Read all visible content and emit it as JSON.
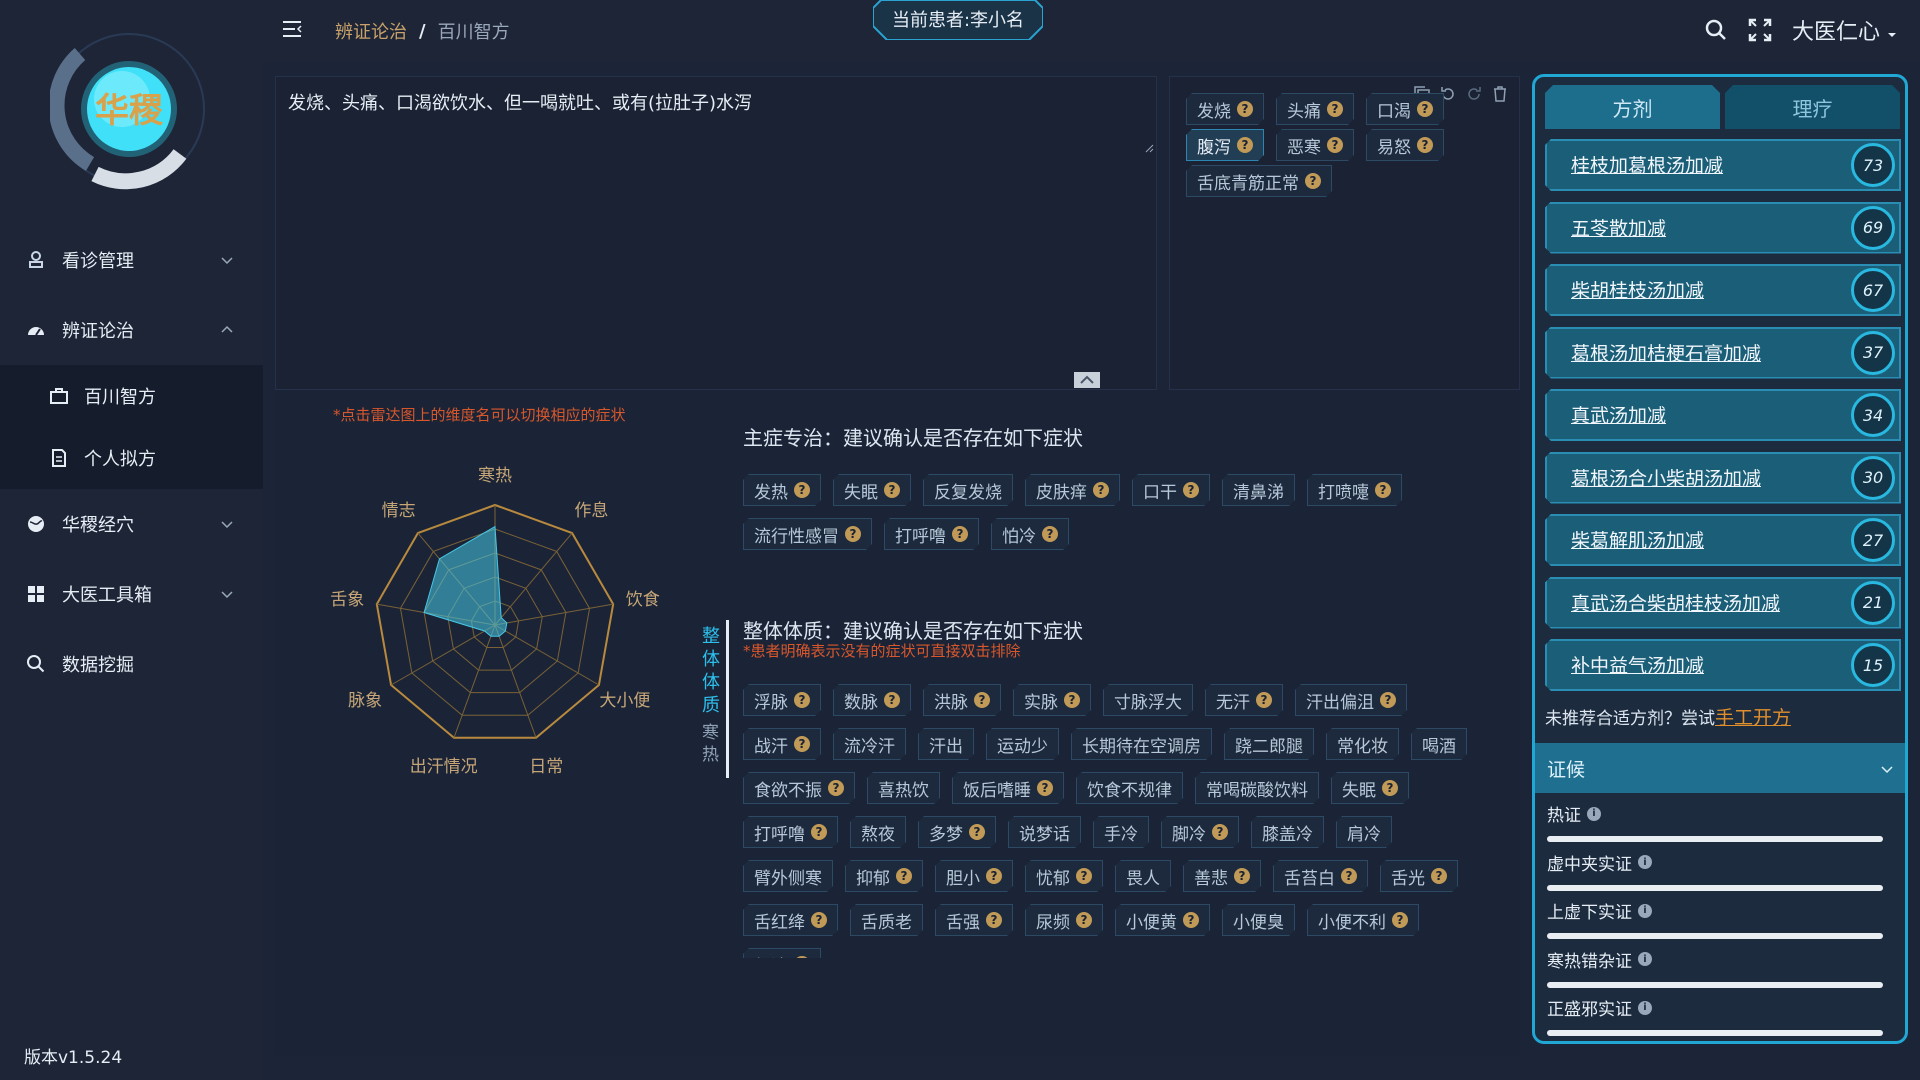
{
  "sidebar": {
    "logo_text": "华稷",
    "items": [
      {
        "label": "看诊管理"
      },
      {
        "label": "辨证论治"
      },
      {
        "label": "华稷经穴"
      },
      {
        "label": "大医工具箱"
      },
      {
        "label": "数据挖掘"
      }
    ],
    "sub_items": [
      {
        "label": "百川智方"
      },
      {
        "label": "个人拟方"
      }
    ],
    "version": "版本v1.5.24"
  },
  "header": {
    "breadcrumb": [
      "辨证论治",
      "/",
      "百川智方"
    ],
    "patient_label": "当前患者:李小名",
    "user_name": "大医仁心"
  },
  "symptom_input": {
    "value": "发烧、头痛、口渴欲饮水、但一喝就吐、或有(拉肚子)水泻"
  },
  "selected_tags": [
    {
      "label": "发烧",
      "selected": false
    },
    {
      "label": "头痛",
      "selected": false
    },
    {
      "label": "口渴",
      "selected": false
    },
    {
      "label": "腹泻",
      "selected": true
    },
    {
      "label": "恶寒",
      "selected": false
    },
    {
      "label": "易怒",
      "selected": false
    },
    {
      "label": "舌底青筋正常",
      "selected": false
    }
  ],
  "radar": {
    "hint": "*点击雷达图上的维度名可以切换相应的症状",
    "dimensions": [
      "寒热",
      "作息",
      "饮食",
      "大小便",
      "日常",
      "出汗情况",
      "脉象",
      "舌象",
      "情志"
    ],
    "levels": 5,
    "values": [
      0.82,
      0.08,
      0.1,
      0.1,
      0.1,
      0.1,
      0.1,
      0.6,
      0.72
    ]
  },
  "main_section": {
    "title": "主症专治：建议确认是否存在如下症状",
    "tags": [
      {
        "label": "发热",
        "q": true
      },
      {
        "label": "失眠",
        "q": true
      },
      {
        "label": "反复发烧",
        "q": false
      },
      {
        "label": "皮肤痒",
        "q": true
      },
      {
        "label": "口干",
        "q": true
      },
      {
        "label": "清鼻涕",
        "q": false
      },
      {
        "label": "打喷嚏",
        "q": true
      },
      {
        "label": "流行性感冒",
        "q": true
      },
      {
        "label": "打呼噜",
        "q": true
      },
      {
        "label": "怕冷",
        "q": true
      }
    ]
  },
  "constitution_section": {
    "side_tabs": [
      "整体体质",
      "寒热"
    ],
    "title": "整体体质：建议确认是否存在如下症状",
    "hint": "*患者明确表示没有的症状可直接双击排除",
    "tags": [
      {
        "label": "浮脉",
        "q": true
      },
      {
        "label": "数脉",
        "q": true
      },
      {
        "label": "洪脉",
        "q": true
      },
      {
        "label": "实脉",
        "q": true
      },
      {
        "label": "寸脉浮大",
        "q": false
      },
      {
        "label": "无汗",
        "q": true
      },
      {
        "label": "汗出偏沮",
        "q": true
      },
      {
        "label": "战汗",
        "q": true
      },
      {
        "label": "流冷汗",
        "q": false
      },
      {
        "label": "汗出",
        "q": false
      },
      {
        "label": "运动少",
        "q": false
      },
      {
        "label": "长期待在空调房",
        "q": false
      },
      {
        "label": "跷二郎腿",
        "q": false
      },
      {
        "label": "常化妆",
        "q": false
      },
      {
        "label": "喝酒",
        "q": false
      },
      {
        "label": "食欲不振",
        "q": true
      },
      {
        "label": "喜热饮",
        "q": false
      },
      {
        "label": "饭后嗜睡",
        "q": true
      },
      {
        "label": "饮食不规律",
        "q": false
      },
      {
        "label": "常喝碳酸饮料",
        "q": false
      },
      {
        "label": "失眠",
        "q": true
      },
      {
        "label": "打呼噜",
        "q": true
      },
      {
        "label": "熬夜",
        "q": false
      },
      {
        "label": "多梦",
        "q": true
      },
      {
        "label": "说梦话",
        "q": false
      },
      {
        "label": "手冷",
        "q": false
      },
      {
        "label": "脚冷",
        "q": true
      },
      {
        "label": "膝盖冷",
        "q": false
      },
      {
        "label": "肩冷",
        "q": false
      },
      {
        "label": "臂外侧寒",
        "q": false
      },
      {
        "label": "抑郁",
        "q": true
      },
      {
        "label": "胆小",
        "q": true
      },
      {
        "label": "忧郁",
        "q": true
      },
      {
        "label": "畏人",
        "q": false
      },
      {
        "label": "善悲",
        "q": true
      },
      {
        "label": "舌苔白",
        "q": true
      },
      {
        "label": "舌光",
        "q": true
      },
      {
        "label": "舌红绛",
        "q": true
      },
      {
        "label": "舌质老",
        "q": false
      },
      {
        "label": "舌强",
        "q": true
      },
      {
        "label": "尿频",
        "q": true
      },
      {
        "label": "小便黄",
        "q": true
      },
      {
        "label": "小便臭",
        "q": false
      },
      {
        "label": "小便不利",
        "q": true
      },
      {
        "label": "便溏",
        "q": true
      }
    ]
  },
  "right_panel": {
    "tabs": [
      "方剂",
      "理疗"
    ],
    "prescriptions": [
      {
        "name": "桂枝加葛根汤加减",
        "score": "73"
      },
      {
        "name": "五苓散加减",
        "score": "69"
      },
      {
        "name": "柴胡桂枝汤加减",
        "score": "67"
      },
      {
        "name": "葛根汤加桔梗石膏加减",
        "score": "37"
      },
      {
        "name": "真武汤加减",
        "score": "34"
      },
      {
        "name": "葛根汤合小柴胡汤加减",
        "score": "30"
      },
      {
        "name": "柴葛解肌汤加减",
        "score": "27"
      },
      {
        "name": "真武汤合柴胡桂枝汤加减",
        "score": "21"
      },
      {
        "name": "补中益气汤加减",
        "score": "15"
      }
    ],
    "no_match_text": "未推荐合适方剂？尝试",
    "no_match_link": "手工开方",
    "syndrome_header": "证候",
    "syndromes": [
      {
        "label": "热证"
      },
      {
        "label": "虚中夹实证"
      },
      {
        "label": "上虚下实证"
      },
      {
        "label": "寒热错杂证"
      },
      {
        "label": "正盛邪实证"
      }
    ]
  }
}
